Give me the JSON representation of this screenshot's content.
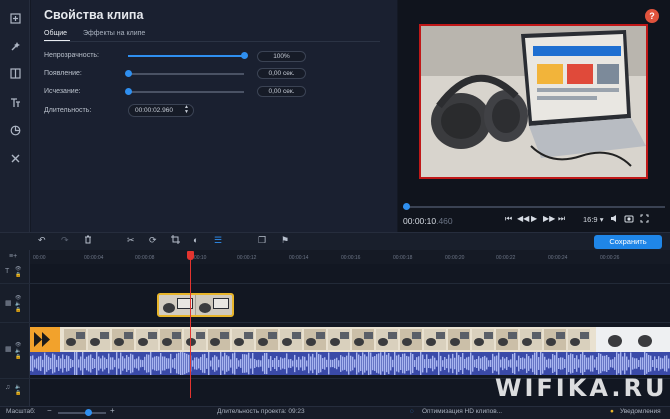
{
  "colors": {
    "accent": "#2f8ff0",
    "save": "#1f86e8",
    "help": "#e0533d",
    "playhead": "#e3342f",
    "selection": "#e8b52a",
    "frame": "#c01818"
  },
  "leftbar": {
    "items": [
      {
        "icon": "import-icon"
      },
      {
        "icon": "magic-wand-icon"
      },
      {
        "icon": "transitions-icon"
      },
      {
        "icon": "titles-icon"
      },
      {
        "icon": "stickers-icon"
      },
      {
        "icon": "tools-icon"
      }
    ]
  },
  "props": {
    "title": "Свойства клипа",
    "tabs": [
      {
        "label": "Общие",
        "active": true
      },
      {
        "label": "Эффекты на клипе",
        "active": false
      }
    ],
    "opacity": {
      "label": "Непрозрачность:",
      "value": "100%",
      "level": 1.0
    },
    "fadein": {
      "label": "Появление:",
      "value": "0,00 сек.",
      "level": 0.0
    },
    "fadeout": {
      "label": "Исчезание:",
      "value": "0,00 сек.",
      "level": 0.0
    },
    "duration": {
      "label": "Длительность:",
      "value": "00:00:02.960"
    }
  },
  "preview": {
    "help": "?",
    "timecode_main": "00:00:10",
    "timecode_ms": ".460",
    "ratio": "16:9",
    "progress": 0.0
  },
  "toolbar": {
    "save": "Сохранить"
  },
  "ruler": {
    "ticks": [
      "00:00",
      "00:00:04",
      "00:00:08",
      "00:00:10",
      "00:00:12",
      "00:00:14",
      "00:00:16",
      "00:00:18",
      "00:00:20",
      "00:00:22",
      "00:00:24",
      "00:00:26"
    ]
  },
  "status": {
    "zoom_label": "Масштаб:",
    "project_duration": "Длительность проекта:  09:23",
    "hd_optimization": "Оптимизация HD клипов...",
    "notifications": "Уведомления"
  },
  "watermark": "WIFIKA.RU"
}
